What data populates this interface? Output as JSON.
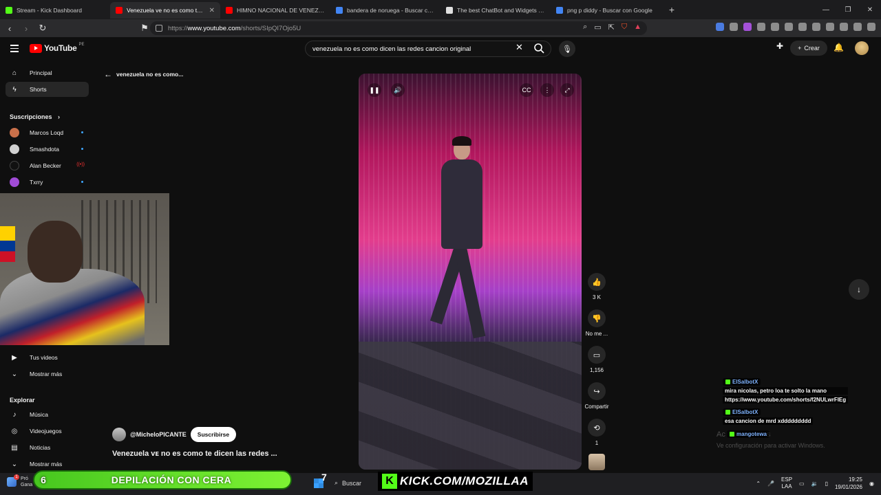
{
  "browser": {
    "tabs": [
      {
        "label": "Stream - Kick Dashboard",
        "color": "#53fc18",
        "active": false
      },
      {
        "label": "Venezuela ve no es como te d",
        "color": "#ff0000",
        "active": true
      },
      {
        "label": "HIMNO NACIONAL DE VENEZUELA",
        "color": "#ff0000",
        "active": false
      },
      {
        "label": "bandera de noruega - Buscar con Go",
        "color": "#4285f4",
        "active": false
      },
      {
        "label": "The best ChatBot and Widgets for K",
        "color": "#e0e0e0",
        "active": false
      },
      {
        "label": "png p diddy - Buscar con Google",
        "color": "#4285f4",
        "active": false
      }
    ],
    "url": "https://www.youtube.com/shorts/SIpQI7Ojo5U",
    "url_prefix": "https://",
    "url_host": "www.youtube.com",
    "url_path": "/shorts/SIpQI7Ojo5U"
  },
  "youtube": {
    "logo_text": "YouTube",
    "logo_region": "PE",
    "search_value": "venezuela no es como dicen las redes cancion original",
    "create_label": "Crear"
  },
  "sidebar": {
    "items": [
      {
        "label": "Principal",
        "icon": "home-icon"
      },
      {
        "label": "Shorts",
        "icon": "shorts-icon"
      }
    ],
    "subscriptions_heading": "Suscripciones",
    "subscriptions": [
      {
        "label": "Marcos Loqd",
        "color": "#c9704a"
      },
      {
        "label": "Smashdota",
        "color": "#d0d0d0"
      },
      {
        "label": "Alan Becker",
        "color": "#111111"
      },
      {
        "label": "Txrry",
        "color": "#a04bd6"
      }
    ],
    "you_items": [
      {
        "label": "Tus videos",
        "icon": "video-icon"
      },
      {
        "label": "Mostrar más",
        "icon": "chevron-down-icon"
      }
    ],
    "explore_heading": "Explorar",
    "explore_items": [
      {
        "label": "Música",
        "icon": "music-icon"
      },
      {
        "label": "Videojuegos",
        "icon": "gamepad-icon"
      },
      {
        "label": "Noticias",
        "icon": "news-icon"
      },
      {
        "label": "Mostrar más",
        "icon": "chevron-down-icon"
      }
    ]
  },
  "short": {
    "back_label": "venezuela no es como...",
    "likes": "3 K",
    "dislike_label": "No me ...",
    "comments": "1,156",
    "share_label": "Compartir",
    "remix_count": "1",
    "channel": "@MicheloPICANTE",
    "subscribe_label": "Suscribirse",
    "title": "Venezuela ᴠᴇ no es como te dicen las redes ..."
  },
  "chat": [
    {
      "user": "ElSalbotX",
      "lines": [
        "mira nicolas, petro loa te solto la mano",
        "https://www.youtube.com/shorts/f2NULwrFIEg"
      ]
    },
    {
      "user": "ElSalbotX",
      "lines": [
        "esa cancion de mrd xddddddddd"
      ]
    },
    {
      "user": "mangotewa",
      "lines": []
    }
  ],
  "windows_watermark": {
    "line1": "Ac",
    "line1_tail": "s",
    "line2": "Ve",
    "line2_tail": "configuración para activar Windows."
  },
  "overlay": {
    "promo_left_number": "6",
    "promo_text": "DEPILACIÓN CON CERA",
    "promo_right_number": "7",
    "kick_text": "KICK.COM/MOZILLAA"
  },
  "taskbar": {
    "left_app_line1": "Pró",
    "left_app_line2": "Gana",
    "search_label": "Buscar",
    "lang_line1": "ESP",
    "lang_line2": "LAA",
    "time": "19:25",
    "date": "19/01/2026"
  }
}
